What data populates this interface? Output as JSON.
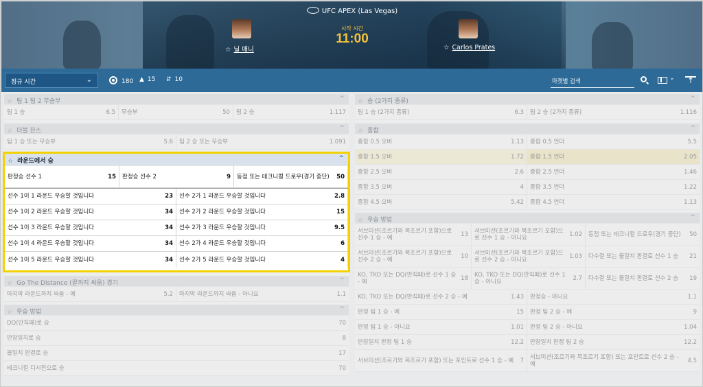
{
  "header": {
    "venue": "UFC APEX (Las Vegas)",
    "start_label": "시작 시간",
    "time": "11:00",
    "fighter1": "닐 매니",
    "fighter2": "Carlos Prates"
  },
  "toolbar": {
    "period": "정규 시간",
    "count_all": "180",
    "count_live": "15",
    "count_updown": "10",
    "search_placeholder": "마켓별 검색"
  },
  "left": {
    "team123": {
      "title": "팀 1 팀 2 무승부",
      "rows": [
        [
          [
            "팀 1 승",
            "6.5"
          ],
          [
            "무승부",
            "50"
          ],
          [
            "팀 2 승",
            "1.117"
          ]
        ]
      ]
    },
    "double": {
      "title": "더블 찬스",
      "rows": [
        [
          [
            "팀 1 승 또는 무승부",
            "5.6"
          ],
          [
            "팀 2 승 또는 무승부",
            "1.091"
          ]
        ]
      ]
    },
    "round": {
      "title": "라운드에서 승",
      "top": [
        [
          "판정승 선수 1",
          "15"
        ],
        [
          "판정승 선수 2",
          "9"
        ],
        [
          "동점 또는 테크니컬 드로우(경기 중단)",
          "50"
        ]
      ],
      "rows": [
        [
          [
            "선수 1이 1 라운드 우승할 것입니다",
            "23"
          ],
          [
            "선수 2가 1 라운드 우승할 것입니다",
            "2.8"
          ]
        ],
        [
          [
            "선수 1이 2 라운드 우승할 것입니다",
            "34"
          ],
          [
            "선수 2가 2 라운드 우승할 것입니다",
            "15"
          ]
        ],
        [
          [
            "선수 1이 3 라운드 우승할 것입니다",
            "34"
          ],
          [
            "선수 2가 3 라운드 우승할 것입니다",
            "9.5"
          ]
        ],
        [
          [
            "선수 1이 4 라운드 우승할 것입니다",
            "34"
          ],
          [
            "선수 2가 4 라운드 우승할 것입니다",
            "6"
          ]
        ],
        [
          [
            "선수 1이 5 라운드 우승할 것입니다",
            "34"
          ],
          [
            "선수 2가 5 라운드 우승할 것입니다",
            "4"
          ]
        ]
      ]
    },
    "distance": {
      "title": "Go The Distance (끝까지 싸움) 경기",
      "rows": [
        [
          [
            "마지막 라운드까지 싸움 - 예",
            "5.2"
          ],
          [
            "마지막 라운드까지 싸움 - 아니요",
            "1.1"
          ]
        ]
      ]
    },
    "method": {
      "title": "우승 방법",
      "rows": [
        [
          [
            "DQ(반칙패)로 승",
            "70"
          ]
        ],
        [
          [
            "만장일치로 승",
            "8"
          ]
        ],
        [
          [
            "불일치 판결로 승",
            "17"
          ]
        ],
        [
          [
            "테크니컬 디시전으로 승",
            "70"
          ]
        ]
      ]
    }
  },
  "right": {
    "win2": {
      "title": "승 (2가지 종류)",
      "rows": [
        [
          [
            "팀 1 승 (2가지 종류)",
            "6.3"
          ],
          [
            "팀 2 승 (2가지 종류)",
            "1.116"
          ]
        ]
      ]
    },
    "total": {
      "title": "종합",
      "rows": [
        [
          [
            "종합 0.5 오버",
            "1.13"
          ],
          [
            "종합 0.5 언더",
            "5.5"
          ]
        ],
        [
          [
            "종합 1.5 오버",
            "1.72"
          ],
          [
            "종합 1.5 언더",
            "2.05"
          ]
        ],
        [
          [
            "종합 2.5 오버",
            "2.6"
          ],
          [
            "종합 2.5 언더",
            "1.46"
          ]
        ],
        [
          [
            "종합 3.5 오버",
            "4"
          ],
          [
            "종합 3.5 언더",
            "1.22"
          ]
        ],
        [
          [
            "종합 4.5 오버",
            "5.42"
          ],
          [
            "종합 4.5 언더",
            "1.13"
          ]
        ]
      ]
    },
    "method": {
      "title": "우승 방법",
      "rows": [
        [
          [
            "서브미션(조르기와 목조르기 포함)으로 선수 1 승 - 예",
            "13"
          ],
          [
            "서브미션(조르기와 목조르기 포함)으로 선수 1 승 - 아니요",
            "1.02"
          ],
          [
            "동점 또는 테크니컬 드로우(경기 중단)",
            "50"
          ]
        ],
        [
          [
            "서브미션(조르기와 목조르기 포함)으로 선수 2 승 - 예",
            "10"
          ],
          [
            "서브미션(조르기와 목조르기 포함)으로 선수 2 승 - 아니요",
            "1.03"
          ],
          [
            "다수결 또는 불일치 판결로 선수 1 승",
            "21"
          ]
        ],
        [
          [
            "KO, TKO 또는 DQ(반칙패)로 선수 1 승 - 예",
            "18"
          ],
          [
            "KO, TKO 또는 DQ(반칙패)로 선수 1 승 - 아니요",
            "2.7"
          ],
          [
            "다수결 또는 불일치 판결로 선수 2 승",
            "19"
          ]
        ]
      ],
      "rows2": [
        [
          [
            "KO, TKO 또는 DQ(반칙패)로 선수 2 승 - 예",
            "1.43"
          ],
          [
            "판정승 - 아니요",
            "1.1"
          ]
        ],
        [
          [
            "판정 팀 1 승 - 예",
            "15"
          ],
          [
            "판정 팀 2 승 - 예",
            "9"
          ]
        ],
        [
          [
            "판정 팀 1 승 - 아니요",
            "1.01"
          ],
          [
            "판정 팀 2 승 - 아니요",
            "1.04"
          ]
        ],
        [
          [
            "만장일치 판정 팀 1 승",
            "12.2"
          ],
          [
            "만장일치 판정 팀 2 승",
            "12.2"
          ]
        ],
        [
          [
            "서브미션(조르기와 목조르기 포함) 또는 포인트로 선수 1 승 - 예",
            "7"
          ],
          [
            "서브미션(조르기와 목조르기 포함) 또는 포인트로 선수 2 승 - 예",
            "4.5"
          ]
        ]
      ]
    }
  },
  "labels": {
    "star": "☆",
    "up": "^"
  }
}
